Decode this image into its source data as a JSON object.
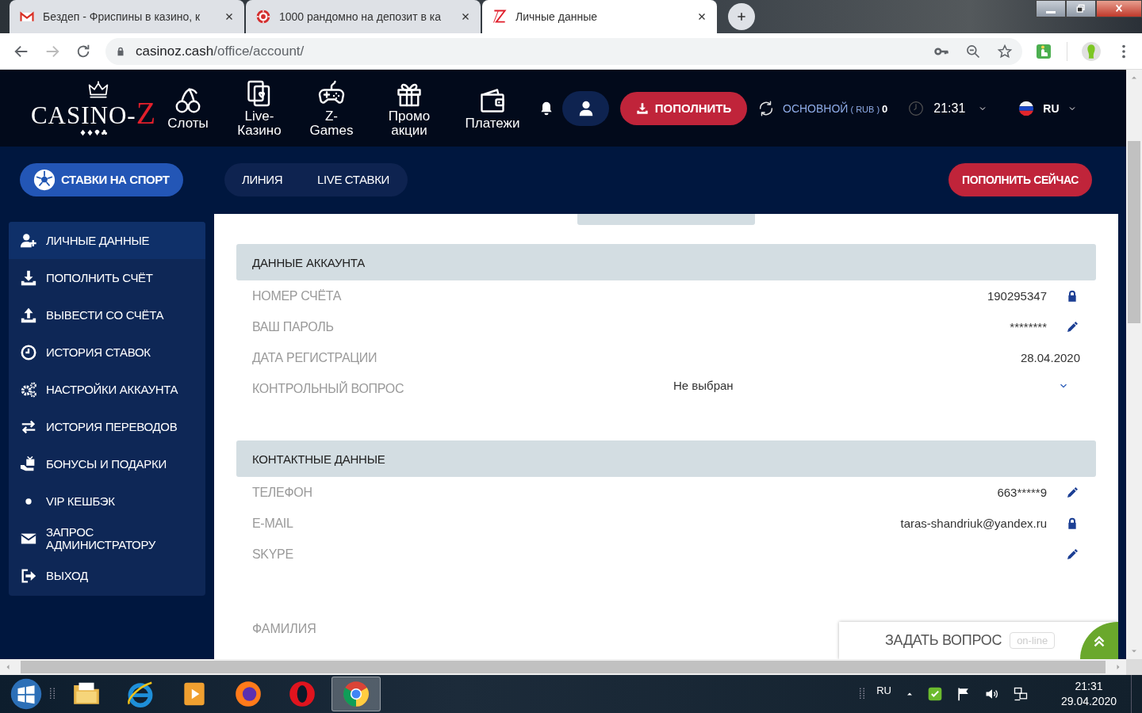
{
  "browser": {
    "tabs": [
      {
        "title": "Бездеп - Фриспины в казино, к",
        "kind": "mail",
        "selected": false
      },
      {
        "title": "1000 рандомно на депозит в ка",
        "kind": "wheel",
        "selected": false
      },
      {
        "title": "Личные данные",
        "kind": "zmark",
        "selected": true
      }
    ],
    "url_host": "casinoz.cash",
    "url_path": "/office/account/"
  },
  "header": {
    "logo": {
      "text": "CASINO-",
      "accent": "Z"
    },
    "nav": [
      {
        "label": "Слоты",
        "kind": "cherries"
      },
      {
        "label": "Live-Казино",
        "kind": "cards"
      },
      {
        "label": "Z-Games",
        "kind": "gamepad"
      },
      {
        "label": "Промо акции",
        "kind": "gift"
      },
      {
        "label": "Платежи",
        "kind": "wallet"
      }
    ],
    "deposit_button": "ПОПОЛНИТЬ",
    "balance": {
      "label": "ОСНОВНОЙ",
      "currency": "( RUB )",
      "amount": "0"
    },
    "time": "21:31",
    "language": "RU"
  },
  "subnav": {
    "sport_button": "СТАВКИ НА СПОРТ",
    "tabs": [
      {
        "label": "ЛИНИЯ",
        "selected": false
      },
      {
        "label": "LIVE СТАВКИ",
        "selected": false
      }
    ],
    "deposit_now": "ПОПОЛНИТЬ СЕЙЧАС"
  },
  "sidebar": {
    "items": [
      {
        "label": "ЛИЧНЫЕ ДАННЫЕ",
        "kind": "user-plus",
        "selected": true
      },
      {
        "label": "ПОПОЛНИТЬ СЧЁТ",
        "kind": "download",
        "selected": false
      },
      {
        "label": "ВЫВЕСТИ СО СЧЁТА",
        "kind": "upload",
        "selected": false
      },
      {
        "label": "ИСТОРИЯ СТАВОК",
        "kind": "clock",
        "selected": false
      },
      {
        "label": "НАСТРОЙКИ АККАУНТА",
        "kind": "gears",
        "selected": false
      },
      {
        "label": "ИСТОРИЯ ПЕРЕВОДОВ",
        "kind": "arrows",
        "selected": false
      },
      {
        "label": "БОНУСЫ И ПОДАРКИ",
        "kind": "gift-hand",
        "selected": false
      },
      {
        "label": "VIP КЕШБЭК",
        "kind": "dot",
        "selected": false
      },
      {
        "label": "ЗАПРОС АДМИНИСТРАТОРУ",
        "kind": "envelope",
        "selected": false
      },
      {
        "label": "ВЫХОД",
        "kind": "exit",
        "selected": false
      }
    ]
  },
  "sections": [
    {
      "title": "ДАННЫЕ АККАУНТА",
      "rows": [
        {
          "label": "НОМЕР СЧЁТА",
          "value": "190295347",
          "kind": "locked"
        },
        {
          "label": "ВАШ ПАРОЛЬ",
          "value": "********",
          "kind": "editable"
        },
        {
          "label": "ДАТА РЕГИСТРАЦИИ",
          "value": "28.04.2020",
          "kind": "plain"
        },
        {
          "label": "КОНТРОЛЬНЫЙ ВОПРОС",
          "value": "Не выбран",
          "kind": "select"
        }
      ]
    },
    {
      "title": "КОНТАКТНЫЕ ДАННЫЕ",
      "rows": [
        {
          "label": "ТЕЛЕФОН",
          "value": "663*****9",
          "kind": "editable"
        },
        {
          "label": "E-MAIL",
          "value": "taras-shandriuk@yandex.ru",
          "kind": "locked"
        },
        {
          "label": "SKYPE",
          "kind": "editable"
        }
      ]
    }
  ],
  "extra_fields": [
    "ФАМИЛИЯ"
  ],
  "chat": {
    "label": "ЗАДАТЬ ВОПРОС",
    "status": "on-line"
  },
  "taskbar": {
    "apps": [
      {
        "kind": "folder",
        "selected": false
      },
      {
        "kind": "ie",
        "selected": false
      },
      {
        "kind": "media",
        "selected": false
      },
      {
        "kind": "firefox",
        "selected": false
      },
      {
        "kind": "opera",
        "selected": false
      },
      {
        "kind": "chrome",
        "selected": true
      }
    ],
    "language": "RU",
    "time": "21:31",
    "date": "29.04.2020"
  }
}
